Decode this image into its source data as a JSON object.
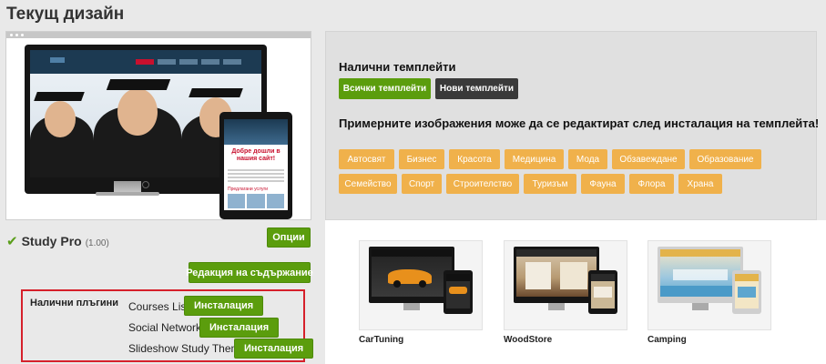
{
  "page": {
    "title": "Текущ дизайн"
  },
  "current_design": {
    "name": "Study Pro",
    "version": "(1.00)",
    "options_label": "Опции",
    "edit_content_label": "Редакция на съдържание",
    "preview": {
      "tablet_heading": "Добре дошли в нашия сайт!",
      "tablet_subheading": "Предлагани услуги"
    }
  },
  "plugins": {
    "label": "Налични плъгини",
    "items": [
      {
        "name": "Courses List",
        "install_label": "Инсталация"
      },
      {
        "name": "Social Networks",
        "install_label": "Инсталация"
      },
      {
        "name": "Slideshow Study Theme",
        "install_label": "Инсталация"
      }
    ]
  },
  "templates": {
    "heading": "Налични темплейти",
    "all_label": "Всички темплейти",
    "new_label": "Нови темплейти",
    "note": "Примерните изображения може да се редактират след инсталация на темплейта!",
    "categories_row1": [
      "Автосвят",
      "Бизнес",
      "Красота",
      "Медицина",
      "Мода",
      "Обзавеждане",
      "Образование"
    ],
    "categories_row2": [
      "Семейство",
      "Спорт",
      "Строителство",
      "Туризъм",
      "Фауна",
      "Флора",
      "Храна"
    ]
  },
  "gallery": {
    "items": [
      {
        "name": "CarTuning",
        "accent": "#e8901c"
      },
      {
        "name": "WoodStore",
        "accent": "#6b4a2e"
      },
      {
        "name": "Camping",
        "accent": "#e3b34a"
      }
    ]
  },
  "colors": {
    "green": "#5b9d0d",
    "orange": "#f0b14b",
    "dark": "#3a3a3a",
    "highlight_border": "#d6202b"
  }
}
